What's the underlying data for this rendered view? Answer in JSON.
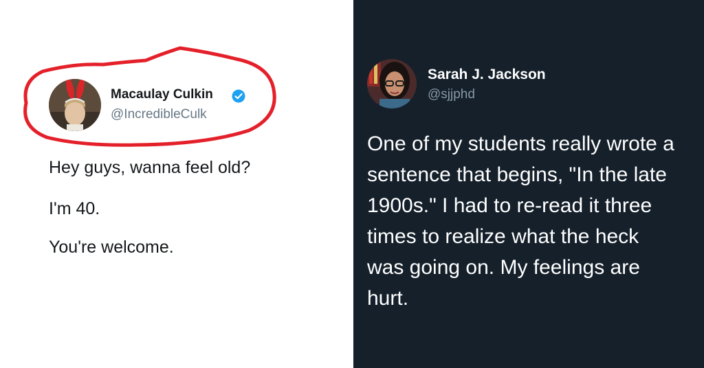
{
  "left_tweet": {
    "display_name": "Macaulay Culkin",
    "handle": "@IncredibleCulk",
    "verified": true,
    "avatar_icon": "profile-photo-bunny-ears",
    "text_lines": [
      "Hey guys, wanna feel old?",
      "I'm 40.",
      "You're welcome."
    ],
    "highlight_color": "#e4202a"
  },
  "right_tweet": {
    "display_name": "Sarah J. Jackson",
    "handle": "@sjjphd",
    "avatar_icon": "profile-photo-glasses",
    "text_lines": [
      "One of my students really wrote a",
      "sentence that begins, \"In the late",
      "1900s.\" I had to re-read it three",
      "times to realize what the heck",
      "was going on. My feelings are",
      "hurt."
    ]
  },
  "colors": {
    "left_background": "#ffffff",
    "right_background": "#15202b",
    "verified_blue": "#1da1f2"
  }
}
